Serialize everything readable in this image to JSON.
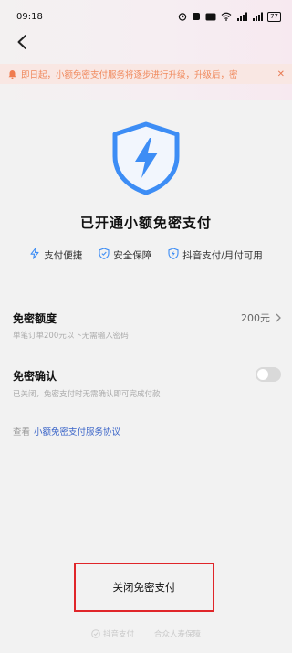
{
  "status_bar": {
    "time": "09:18",
    "battery": "77"
  },
  "notice": {
    "text": "即日起，小额免密支付服务将逐步进行升级，升级后，密"
  },
  "hero": {
    "title": "已开通小额免密支付"
  },
  "features": [
    {
      "label": "支付便捷",
      "icon": "lightning-icon"
    },
    {
      "label": "安全保障",
      "icon": "shield-check-icon"
    },
    {
      "label": "抖音支付/月付可用",
      "icon": "shield-lightning-icon"
    }
  ],
  "limit": {
    "title": "免密额度",
    "value": "200元",
    "desc": "单笔订单200元以下无需输入密码"
  },
  "confirm": {
    "title": "免密确认",
    "desc": "已关闭，免密支付时无需确认即可完成付款",
    "enabled": false
  },
  "agreement": {
    "prefix": "查看",
    "link": "小额免密支付服务协议"
  },
  "close_button": {
    "label": "关闭免密支付"
  },
  "footer": {
    "left": "抖音支付",
    "right": "合众人寿保障"
  },
  "colors": {
    "accent_blue": "#3d8df5",
    "link_blue": "#3a64c8",
    "notice_orange": "#f08a5e",
    "highlight_red": "#e0262a"
  }
}
